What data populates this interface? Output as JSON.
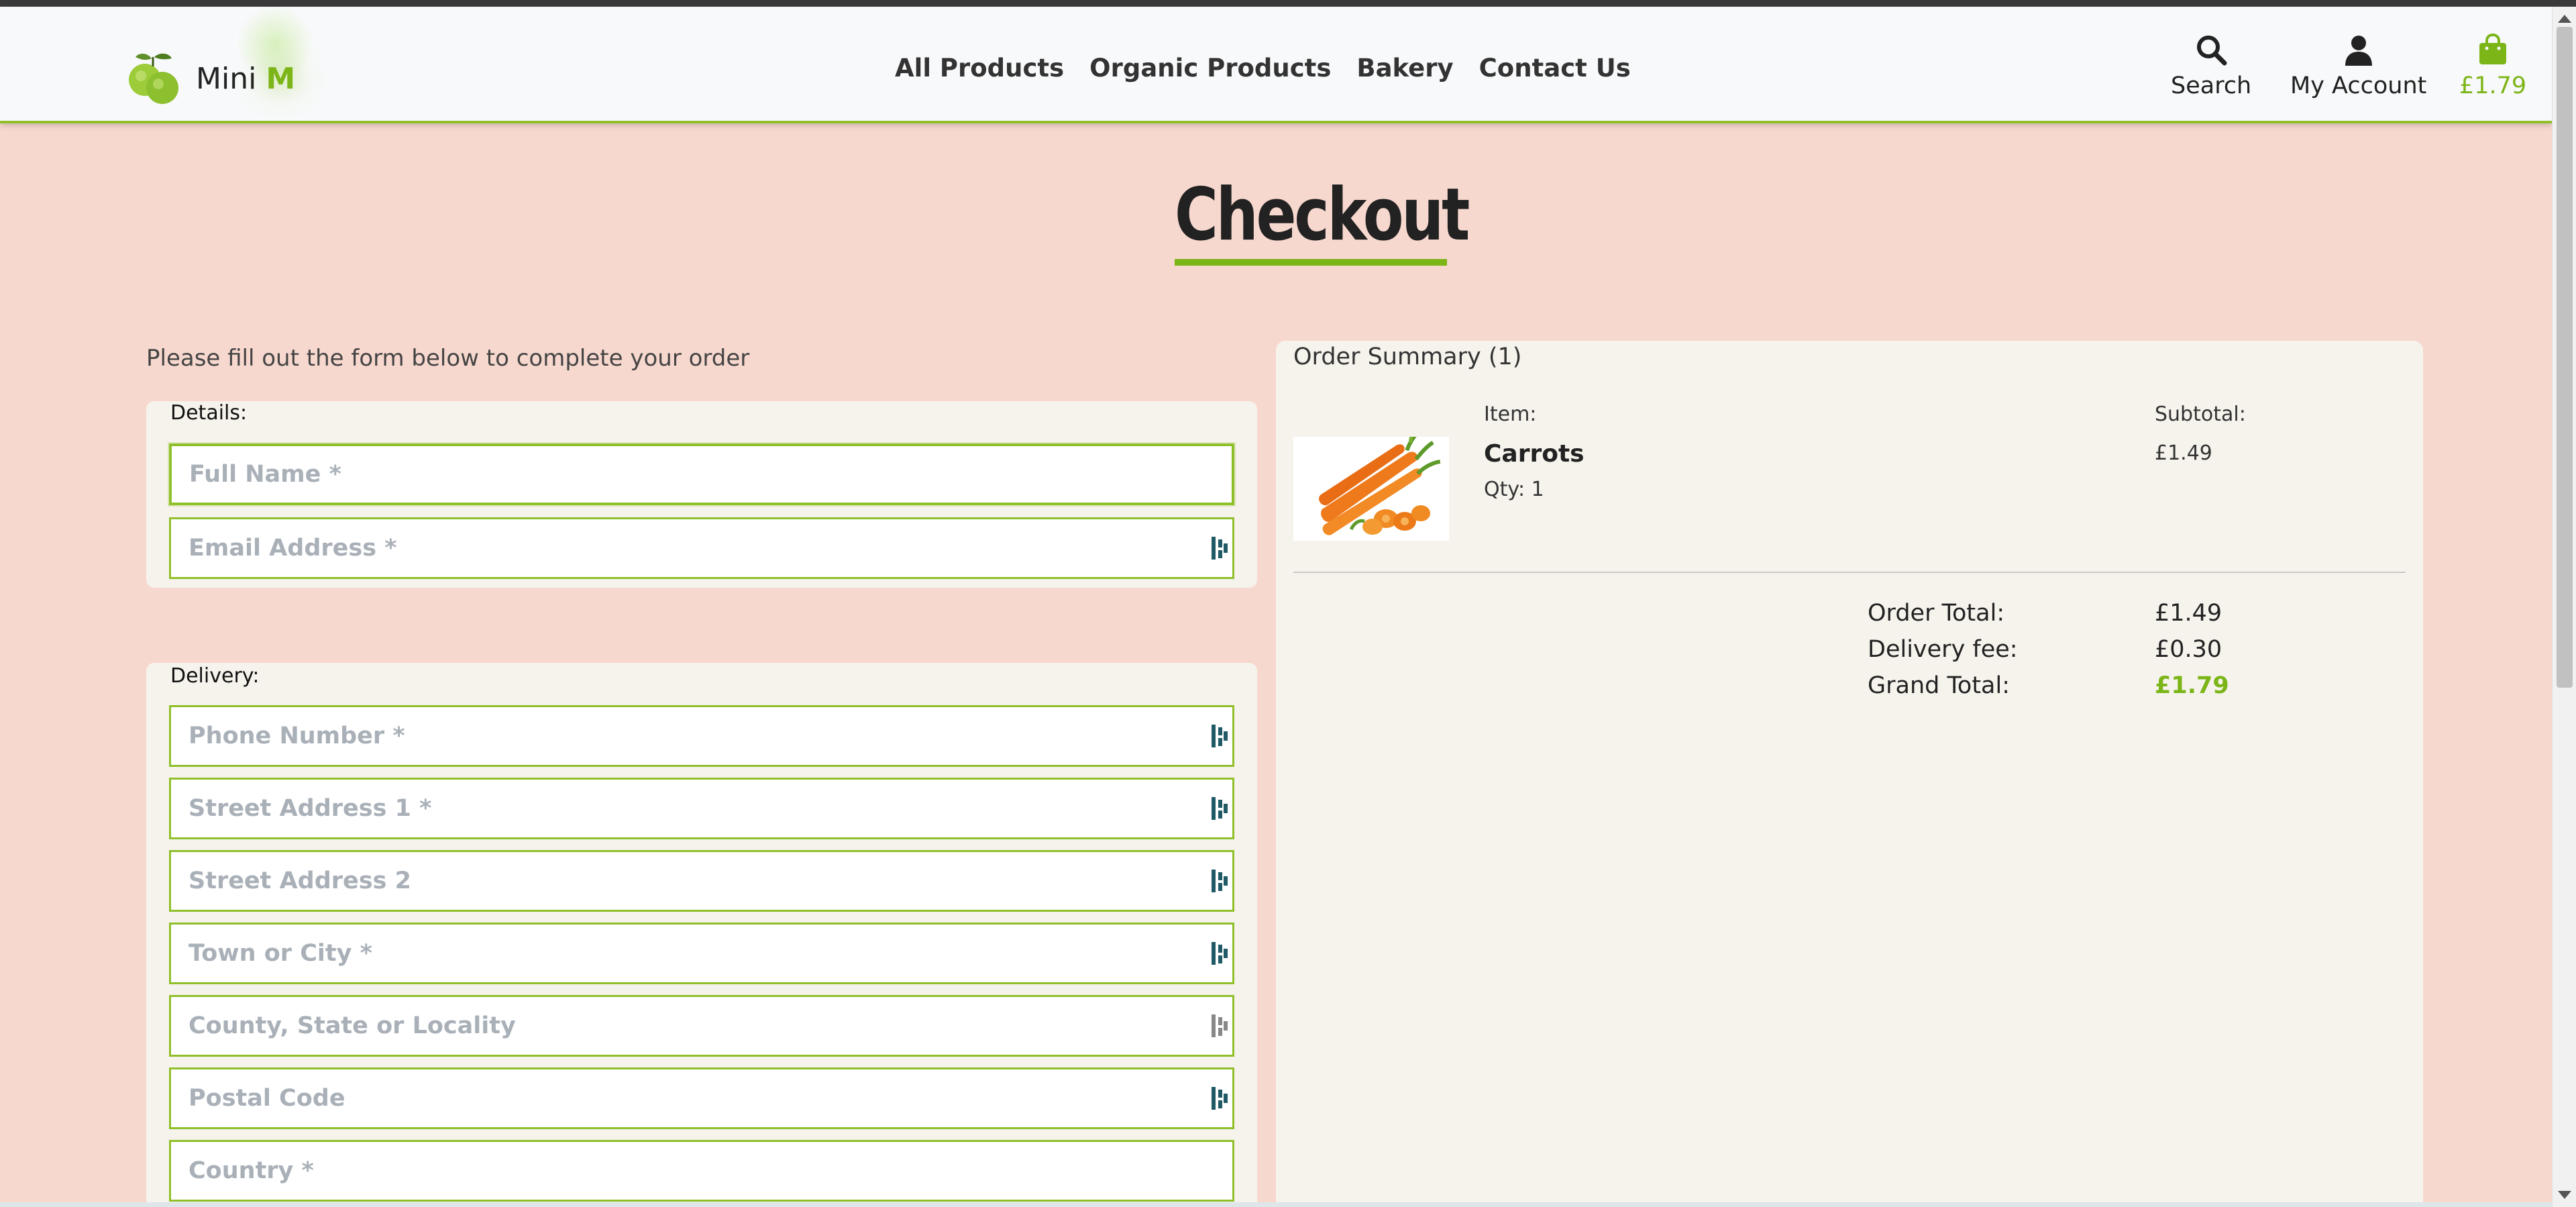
{
  "header": {
    "brand": {
      "name": "Mini",
      "accent_letter": "M"
    },
    "nav": [
      "All Products",
      "Organic Products",
      "Bakery",
      "Contact Us"
    ],
    "search_label": "Search",
    "account_label": "My Account",
    "cart_total": "£1.79"
  },
  "page": {
    "title": "Checkout",
    "intro": "Please fill out the form below to complete your order"
  },
  "details": {
    "label": "Details:",
    "full_name_placeholder": "Full Name *",
    "email_placeholder": "Email Address *"
  },
  "delivery": {
    "label": "Delivery:",
    "phone_placeholder": "Phone Number *",
    "street1_placeholder": "Street Address 1 *",
    "street2_placeholder": "Street Address 2",
    "town_placeholder": "Town or City *",
    "county_placeholder": "County, State or Locality",
    "postal_placeholder": "Postal Code",
    "country_placeholder": "Country *"
  },
  "summary": {
    "title": "Order Summary (1)",
    "item_label": "Item:",
    "subtotal_label": "Subtotal:",
    "items": [
      {
        "name": "Carrots",
        "qty": "Qty: 1",
        "subtotal": "£1.49",
        "image": "carrots"
      }
    ],
    "order_total_label": "Order Total:",
    "order_total": "£1.49",
    "delivery_fee_label": "Delivery fee:",
    "delivery_fee": "£0.30",
    "grand_total_label": "Grand Total:",
    "grand_total": "£1.79"
  },
  "colors": {
    "accent": "#7cb518",
    "page_background": "#f7d8ce",
    "panel_background": "#f6f3ec",
    "field_border": "#8fbf2a"
  }
}
